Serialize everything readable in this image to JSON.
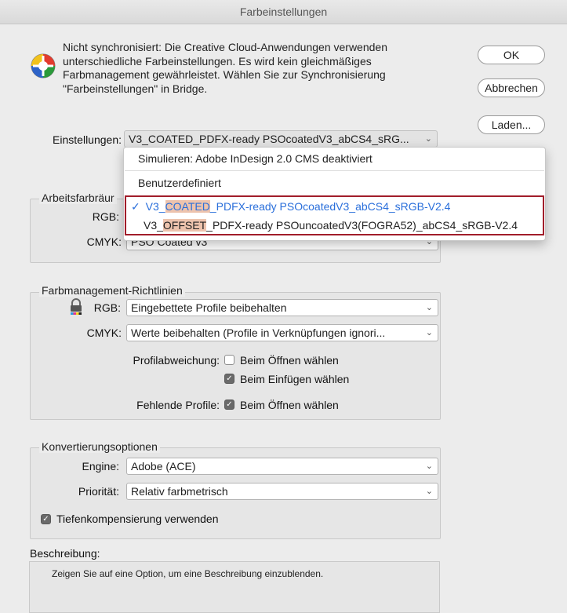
{
  "window": {
    "title": "Farbeinstellungen"
  },
  "warning": {
    "icon": "color-wheel-icon",
    "text": "Nicht synchronisiert: Die Creative Cloud-Anwendungen verwenden unterschiedliche Farbeinstellungen. Es wird kein gleichmäßiges Farbmanagement gewährleistet. Wählen Sie zur Synchronisierung \"Farbeinstellungen\" in Bridge."
  },
  "buttons": {
    "ok": "OK",
    "cancel": "Abbrechen",
    "load": "Laden..."
  },
  "settings": {
    "label": "Einstellungen:",
    "value": "V3_COATED_PDFX-ready PSOcoatedV3_abCS4_sRG..."
  },
  "dropdown": {
    "items": [
      "Simulieren: Adobe InDesign 2.0 CMS deaktiviert",
      "Benutzerdefiniert"
    ],
    "selected": {
      "prefix": "V3_",
      "highlight": "COATED",
      "suffix": "_PDFX-ready PSOcoatedV3_abCS4_sRGB-V2.4",
      "check": "✓"
    },
    "other": {
      "prefix": "V3_",
      "highlight": "OFFSET",
      "suffix": "_PDFX-ready PSOuncoatedV3(FOGRA52)_abCS4_sRGB-V2.4"
    }
  },
  "working_spaces": {
    "legend": "Arbeitsfarbräume",
    "legend_visible": "Arbeitsfarbräur",
    "rgb_label": "RGB:",
    "cmyk_label": "CMYK:",
    "cmyk_value": "PSO Coated v3"
  },
  "policies": {
    "legend": "Farbmanagement-Richtlinien",
    "rgb_label": "RGB:",
    "rgb_value": "Eingebettete Profile beibehalten",
    "cmyk_label": "CMYK:",
    "cmyk_value": "Werte beibehalten (Profile in Verknüpfungen ignori...",
    "mismatch_label": "Profilabweichung:",
    "ask_open": {
      "label": "Beim Öffnen wählen",
      "checked": false
    },
    "ask_paste": {
      "label": "Beim Einfügen wählen",
      "checked": true
    },
    "missing_label": "Fehlende Profile:",
    "missing_open": {
      "label": "Beim Öffnen wählen",
      "checked": true
    }
  },
  "conversion": {
    "legend": "Konvertierungsoptionen",
    "engine_label": "Engine:",
    "engine_value": "Adobe (ACE)",
    "intent_label": "Priorität:",
    "intent_value": "Relativ farbmetrisch",
    "bpc": {
      "label": "Tiefenkompensierung verwenden",
      "checked": true
    }
  },
  "description": {
    "label": "Beschreibung:",
    "text": "Zeigen Sie auf eine Option, um eine Beschreibung einzublenden."
  },
  "colors": {
    "accent": "#2a6fdb",
    "highlight": "#edc3ad",
    "outline": "#a11d2a"
  }
}
